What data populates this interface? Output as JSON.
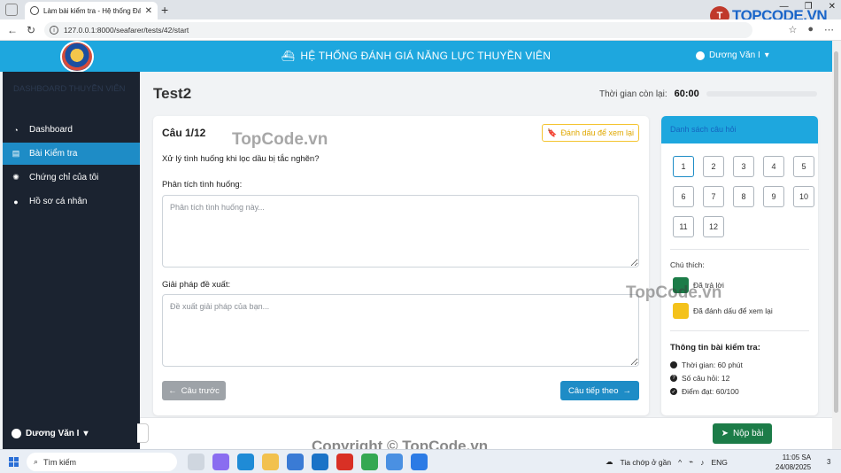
{
  "browser": {
    "tab_title": "Làm bài kiểm tra - Hệ thống Đánh",
    "url": "127.0.0.1:8000/seafarer/tests/42/start",
    "brand": "TOPCODE.VN"
  },
  "header": {
    "title": "HỆ THỐNG ĐÁNH GIÁ NĂNG LỰC THUYỀN VIÊN",
    "user": "Dương Văn I"
  },
  "sidebar": {
    "brand": "DASHBOARD THUYỀN VIÊN",
    "items": [
      {
        "label": "Dashboard",
        "icon": "dashboard-icon"
      },
      {
        "label": "Bài Kiểm tra",
        "icon": "file-icon",
        "active": true
      },
      {
        "label": "Chứng chỉ của tôi",
        "icon": "certificate-icon"
      },
      {
        "label": "Hồ sơ cá nhân",
        "icon": "user-icon"
      }
    ],
    "user": "Dương Văn I"
  },
  "main": {
    "title": "Test2",
    "timer_label": "Thời gian còn lại:",
    "timer_value": "60:00"
  },
  "question": {
    "number": "Câu 1/12",
    "flag_label": "Đánh dấu để xem lại",
    "text": "Xử lý tình huống khi lọc dầu bị tắc nghẽn?",
    "analysis_label": "Phân tích tình huống:",
    "analysis_placeholder": "Phân tích tình huống này...",
    "solution_label": "Giải pháp đề xuất:",
    "solution_placeholder": "Đề xuất giải pháp của bạn...",
    "prev_label": "Câu trước",
    "next_label": "Câu tiếp theo"
  },
  "question_list": {
    "title": "Danh sách câu hỏi",
    "numbers": [
      "1",
      "2",
      "3",
      "4",
      "5",
      "6",
      "7",
      "8",
      "9",
      "10",
      "11",
      "12"
    ],
    "current": "1",
    "legend_title": "Chú thích:",
    "legend": [
      {
        "label": "Đã trả lời",
        "color": "#1c7c48"
      },
      {
        "label": "Đã đánh dấu để xem lại",
        "color": "#f4c21b"
      }
    ],
    "info_title": "Thông tin bài kiểm tra:",
    "info": [
      {
        "label": "Thời gian: 60 phút",
        "icon": "clock-icon"
      },
      {
        "label": "Số câu hỏi: 12",
        "icon": "question-icon"
      },
      {
        "label": "Điểm đạt: 60/100",
        "icon": "check-icon"
      }
    ]
  },
  "footer": {
    "submit_label": "Nộp bài"
  },
  "watermarks": {
    "a": "TopCode.vn",
    "b": "TopCode.vn",
    "c": "Copyright © TopCode.vn"
  },
  "taskbar": {
    "search_placeholder": "Tìm kiếm",
    "weather": "Tia chớp ở gần",
    "lang": "ENG",
    "time": "11:05 SA",
    "date": "24/08/2025",
    "notifications": "3"
  }
}
